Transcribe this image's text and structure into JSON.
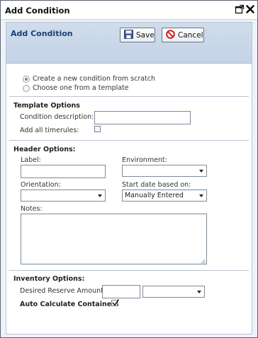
{
  "window": {
    "title": "Add Condition",
    "maximize_icon": "maximize-icon",
    "close_icon": "close-icon"
  },
  "header": {
    "title": "Add Condition",
    "save_label": "Save",
    "cancel_label": "Cancel",
    "save_icon": "floppy-disk-icon",
    "cancel_icon": "prohibited-icon"
  },
  "source": {
    "option_scratch": "Create a new condition from scratch",
    "option_template": "Choose one from a template",
    "selected": "option_scratch"
  },
  "template_options": {
    "heading": "Template Options",
    "description_label": "Condition description:",
    "description_value": "",
    "timerules_label": "Add all timerules:",
    "timerules_checked": false
  },
  "header_options": {
    "heading": "Header Options:",
    "label_label": "Label:",
    "label_value": "",
    "environment_label": "Environment:",
    "environment_value": "",
    "orientation_label": "Orientation:",
    "orientation_value": "",
    "start_date_label": "Start date based on:",
    "start_date_value": "Manually Entered",
    "notes_label": "Notes:",
    "notes_value": ""
  },
  "inventory_options": {
    "heading": "Inventory Options:",
    "reserve_label": "Desired Reserve Amount",
    "reserve_value": "",
    "reserve_unit_value": "",
    "auto_calc_label": "Auto Calculate Containers",
    "auto_calc_checked": true
  }
}
